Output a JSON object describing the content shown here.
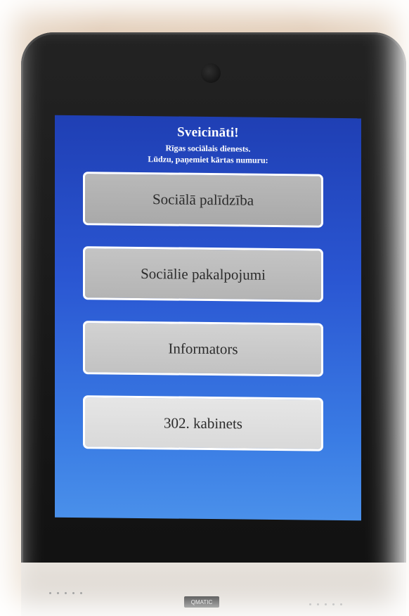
{
  "header": {
    "greeting": "Sveicināti!",
    "organization": "Rīgas sociālais dienests.",
    "instruction": "Lūdzu, paņemiet kārtas numuru:"
  },
  "menu": {
    "items": [
      {
        "label": "Sociālā palīdzība"
      },
      {
        "label": "Sociālie pakalpojumi"
      },
      {
        "label": "Informators"
      },
      {
        "label": "302. kabinets"
      }
    ]
  },
  "device": {
    "brand": "QMATIC"
  },
  "colors": {
    "screen_top": "#1f3fb4",
    "screen_bottom": "#4a90ea",
    "button_text": "#2b2b2b"
  }
}
